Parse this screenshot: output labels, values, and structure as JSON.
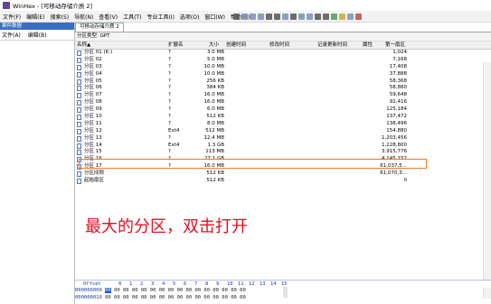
{
  "window": {
    "title": "WinHex - [可移动存储介质 2]"
  },
  "menu": [
    "文件(F)",
    "编辑(E)",
    "搜索(S)",
    "导航(N)",
    "查看(V)",
    "工具(T)",
    "专业工具(I)",
    "选项(O)",
    "窗口(W)",
    "帮助(H)"
  ],
  "left_pane": {
    "header": "案件数据",
    "menu": [
      "文件(A)",
      "编辑(B)"
    ]
  },
  "tab": "可移动存储介质 2",
  "partition_type": "分区类型: GPT",
  "columns": [
    "名称▲",
    "扩展名",
    "大小",
    "创建时间",
    "修改时间",
    "记录更新时间",
    "属性",
    "第一扇区"
  ],
  "partitions": [
    {
      "name": "分区 01 (K:)",
      "ext": "?",
      "size": "3.0 MB",
      "first": "1,024"
    },
    {
      "name": "分区 02",
      "ext": "?",
      "size": "5.0 MB",
      "first": "7,168"
    },
    {
      "name": "分区 03",
      "ext": "?",
      "size": "10.0 MB",
      "first": "17,408"
    },
    {
      "name": "分区 04",
      "ext": "?",
      "size": "10.0 MB",
      "first": "37,888"
    },
    {
      "name": "分区 05",
      "ext": "?",
      "size": "256 KB",
      "first": "58,368"
    },
    {
      "name": "分区 06",
      "ext": "?",
      "size": "384 KB",
      "first": "58,880"
    },
    {
      "name": "分区 07",
      "ext": "?",
      "size": "16.0 MB",
      "first": "59,648"
    },
    {
      "name": "分区 08",
      "ext": "?",
      "size": "16.0 MB",
      "first": "92,416"
    },
    {
      "name": "分区 09",
      "ext": "?",
      "size": "6.0 MB",
      "first": "125,184"
    },
    {
      "name": "分区 10",
      "ext": "?",
      "size": "512 KB",
      "first": "137,472"
    },
    {
      "name": "分区 11",
      "ext": "?",
      "size": "8.0 MB",
      "first": "138,496"
    },
    {
      "name": "分区 12",
      "ext": "Ext4",
      "size": "512 MB",
      "first": "154,880"
    },
    {
      "name": "分区 13",
      "ext": "?",
      "size": "12.4 MB",
      "first": "1,203,456"
    },
    {
      "name": "分区 14",
      "ext": "Ext4",
      "size": "1.3 GB",
      "first": "1,228,800"
    },
    {
      "name": "分区 15",
      "ext": "?",
      "size": "113 MB",
      "first": "3,915,776"
    },
    {
      "name": "分区 16",
      "ext": "?",
      "size": "27.1 GB",
      "first": "4,145,152"
    },
    {
      "name": "分区 17",
      "ext": "?",
      "size": "16.0 MB",
      "first": "61,037,5..."
    },
    {
      "name": "分区间隙",
      "ext": "",
      "size": "512 KB",
      "first": "61,070,3..."
    },
    {
      "name": "起始扇区",
      "ext": "",
      "size": "512 KB",
      "first": "0"
    }
  ],
  "annotation": "最大的分区，双击打开",
  "hex": {
    "header_label": "Offset",
    "header_cols": [
      "0",
      "1",
      "2",
      "3",
      "4",
      "5",
      "6",
      "7",
      "8",
      "9",
      "10",
      "11",
      "12",
      "13",
      "14",
      "15"
    ],
    "rows": [
      {
        "offset": "000000000",
        "first": "00",
        "rest": "00 00 00 00 00 00 00 00 00 00 00 00 00 00 00"
      },
      {
        "offset": "000000010",
        "first": "",
        "rest": "00 00 00 00 00 00 00 00 00 00 00 00 00 00 00 00"
      }
    ]
  },
  "colors": {
    "highlight": "#f07a2e",
    "annotation": "#e01020",
    "accent": "#1a56d8"
  }
}
